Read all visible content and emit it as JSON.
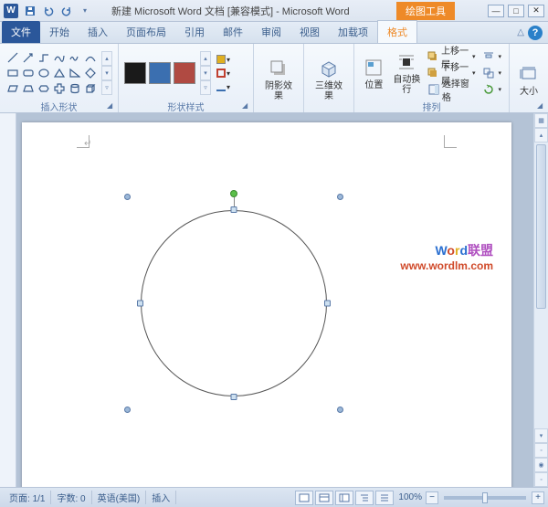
{
  "title": "新建 Microsoft Word 文档 [兼容模式] - Microsoft Word",
  "context_tool": "绘图工具",
  "tabs": {
    "file": "文件",
    "items": [
      "开始",
      "插入",
      "页面布局",
      "引用",
      "邮件",
      "审阅",
      "视图",
      "加载项"
    ],
    "active": "格式"
  },
  "ribbon": {
    "group_insert_shapes": "插入形状",
    "group_shape_styles": "形状样式",
    "group_arrange": "排列",
    "group_size": "大小",
    "shadow_effects": "阴影效果",
    "threed_effects": "三维效果",
    "position": "位置",
    "text_wrap": "自动换行",
    "bring_forward": "上移一层",
    "send_backward": "下移一层",
    "selection_pane": "选择窗格",
    "size": "大小"
  },
  "watermark": {
    "word": "Word",
    "lm": "联盟",
    "url": "www.wordlm.com"
  },
  "status": {
    "page_label": "页面:",
    "page_value": "1/1",
    "words_label": "字数:",
    "words_value": "0",
    "lang": "英语(美国)",
    "mode": "插入",
    "zoom": "100%"
  }
}
